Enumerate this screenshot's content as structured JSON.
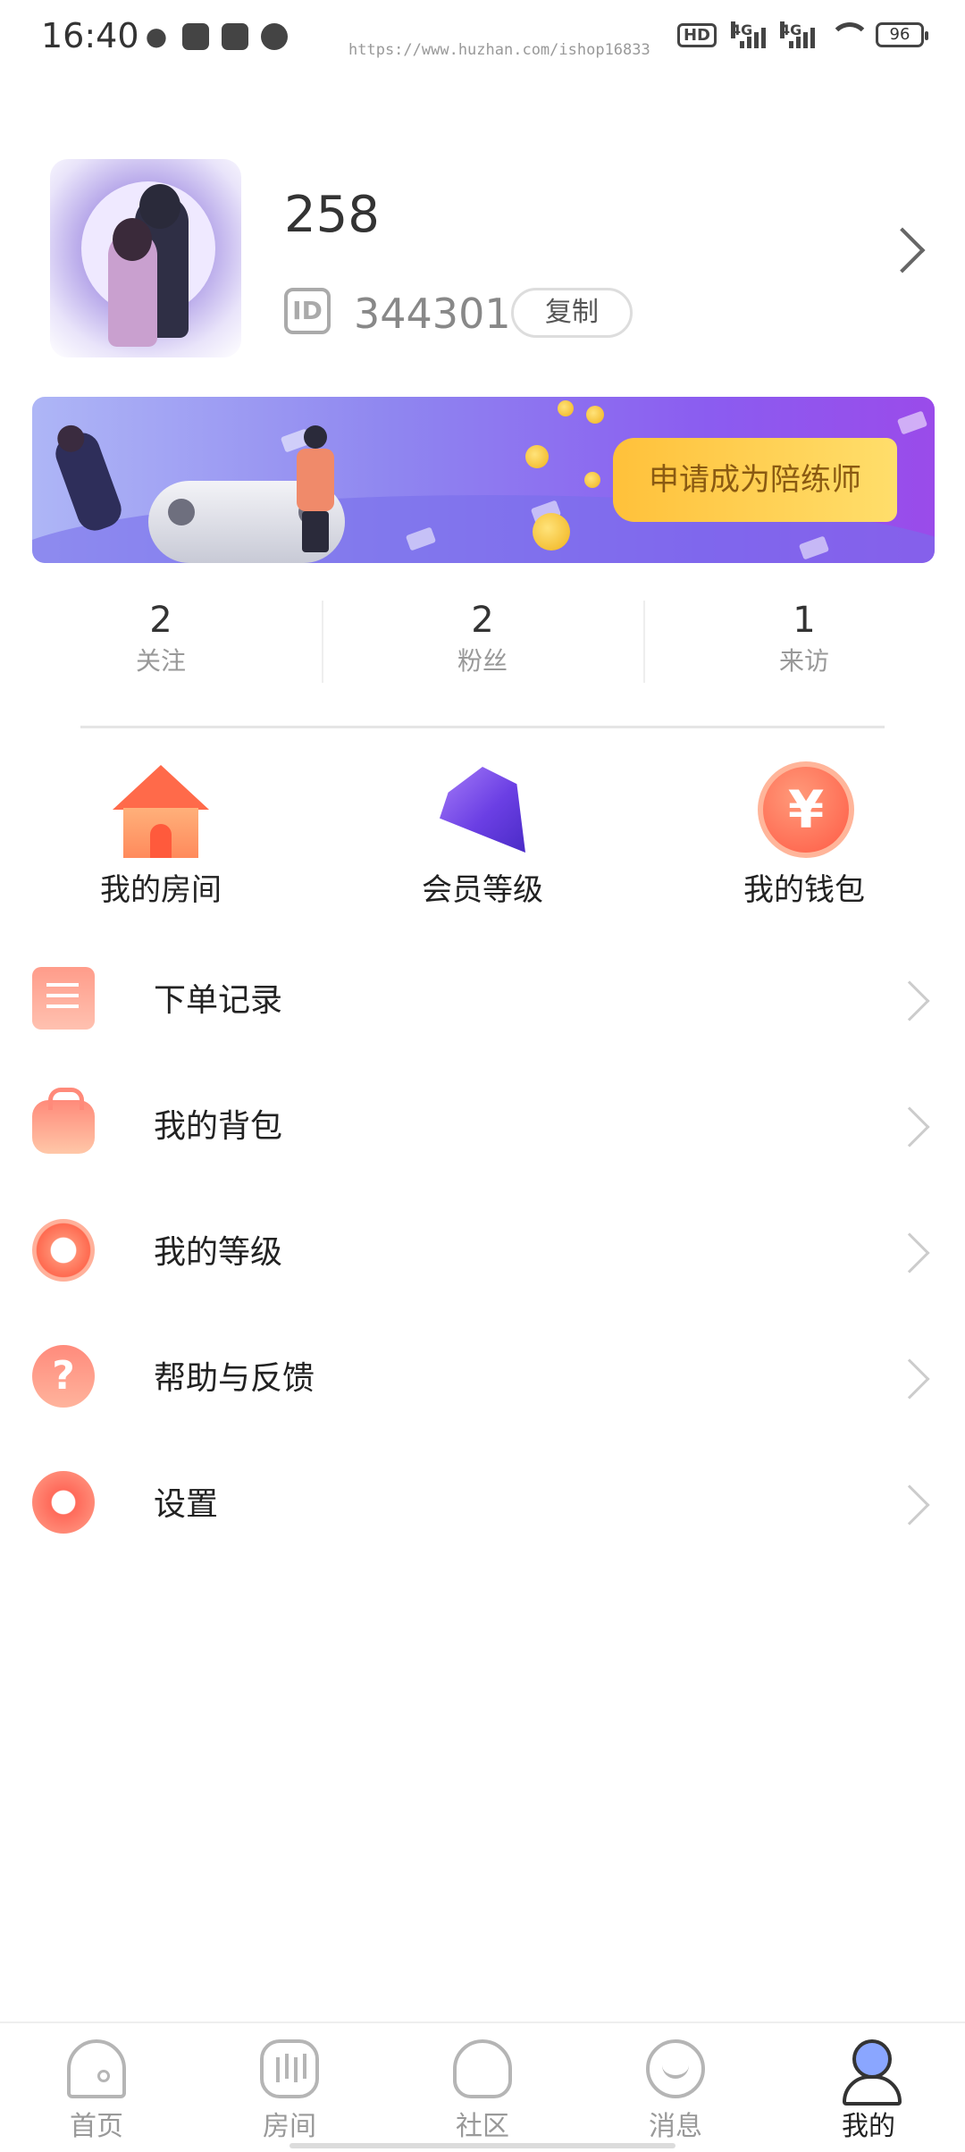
{
  "status_bar": {
    "time": "16:40",
    "watermark": "https://www.huzhan.com/ishop16833",
    "battery": "96",
    "network_1": "4G",
    "network_2": "4G",
    "hd_label": "HD"
  },
  "profile": {
    "username": "258",
    "id_label": "ID",
    "id_value": "344301",
    "copy_label": "复制"
  },
  "banner": {
    "button_label": "申请成为陪练师"
  },
  "stats": [
    {
      "value": "2",
      "label": "关注"
    },
    {
      "value": "2",
      "label": "粉丝"
    },
    {
      "value": "1",
      "label": "来访"
    }
  ],
  "quick_actions": [
    {
      "label": "我的房间",
      "icon": "house-icon"
    },
    {
      "label": "会员等级",
      "icon": "gem-icon"
    },
    {
      "label": "我的钱包",
      "icon": "yuan-coin-icon"
    }
  ],
  "wallet_symbol": "¥",
  "menu": [
    {
      "label": "下单记录",
      "icon": "order-record-icon"
    },
    {
      "label": "我的背包",
      "icon": "backpack-icon"
    },
    {
      "label": "我的等级",
      "icon": "medal-icon"
    },
    {
      "label": "帮助与反馈",
      "icon": "help-icon"
    },
    {
      "label": "设置",
      "icon": "settings-icon"
    }
  ],
  "help_symbol": "?",
  "bottom_nav": [
    {
      "label": "首页",
      "icon": "home-icon",
      "active": false
    },
    {
      "label": "房间",
      "icon": "room-icon",
      "active": false
    },
    {
      "label": "社区",
      "icon": "community-icon",
      "active": false
    },
    {
      "label": "消息",
      "icon": "message-icon",
      "active": false
    },
    {
      "label": "我的",
      "icon": "profile-icon",
      "active": true
    }
  ],
  "colors": {
    "accent_orange": "#ff6a4a",
    "banner_purple": "#8b5cf0",
    "apply_button": "#ffc13a"
  }
}
